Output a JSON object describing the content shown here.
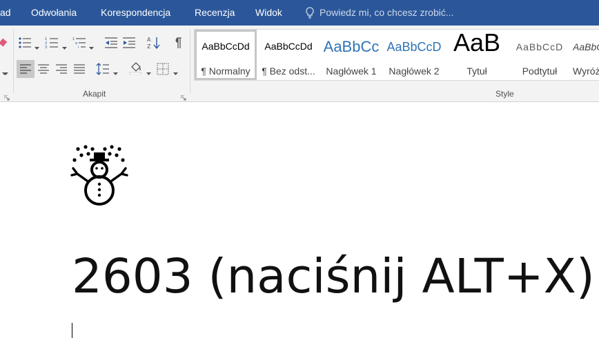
{
  "menu": {
    "items": [
      "ad",
      "Odwołania",
      "Korespondencja",
      "Recenzja",
      "Widok"
    ],
    "tell_me": "Powiedz mi, co chcesz zrobić..."
  },
  "ribbon": {
    "groups": {
      "paragraph": "Akapit",
      "styles": "Style"
    },
    "styles": [
      {
        "preview": "AaBbCcDd",
        "name": "¶ Normalny"
      },
      {
        "preview": "AaBbCcDd",
        "name": "¶ Bez odst..."
      },
      {
        "preview": "AaBbCc",
        "name": "Nagłówek 1"
      },
      {
        "preview": "AaBbCcD",
        "name": "Nagłówek 2"
      },
      {
        "preview": "AaB",
        "name": "Tytuł"
      },
      {
        "preview": "AaBbCcD",
        "name": "Podtytuł"
      },
      {
        "preview": "AaBbC",
        "name": "Wyróż"
      }
    ]
  },
  "document": {
    "inserted_symbol": "snowman-icon",
    "text": "2603 (naciśnij ALT+X)"
  },
  "colors": {
    "ribbon_blue": "#2b579a",
    "heading_blue": "#2e74b5"
  }
}
